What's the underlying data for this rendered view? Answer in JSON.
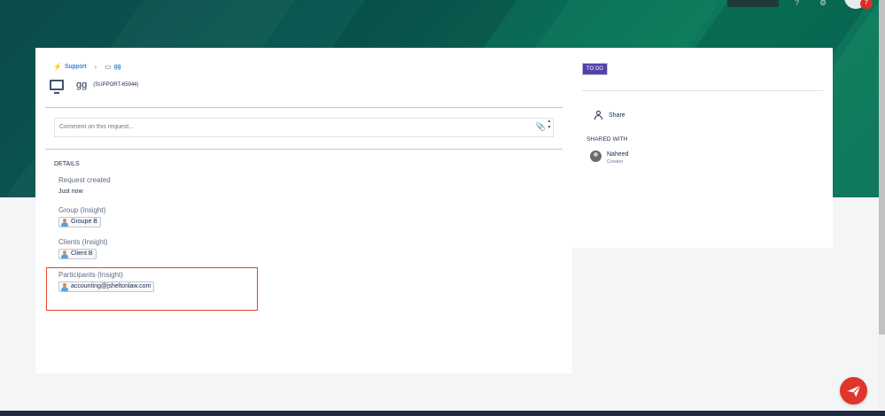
{
  "header": {
    "notification_count": "7"
  },
  "breadcrumb": {
    "project": "Support",
    "request_type": "gg"
  },
  "request": {
    "title": "gg",
    "key": "(SUPPORT-65944)"
  },
  "comment": {
    "placeholder": "Comment on this request..."
  },
  "details": {
    "heading": "DETAILS",
    "created_label": "Request created",
    "created_value": "Just now",
    "group_label": "Group (Insight)",
    "group_value": "Groupe B",
    "clients_label": "Clients (Insight)",
    "clients_value": "Client B",
    "participants_label": "Participants (Insight)",
    "participants_value": "accounting@jsheltonlaw.com"
  },
  "sidebar": {
    "status": "TO DO",
    "share_label": "Share",
    "shared_with_heading": "SHARED WITH",
    "user_name": "Naheed",
    "user_role": "Creator"
  },
  "colors": {
    "status": "#5243aa",
    "highlight": "#e0442f",
    "fab": "#e0352b",
    "banner": "#0a5a52"
  }
}
